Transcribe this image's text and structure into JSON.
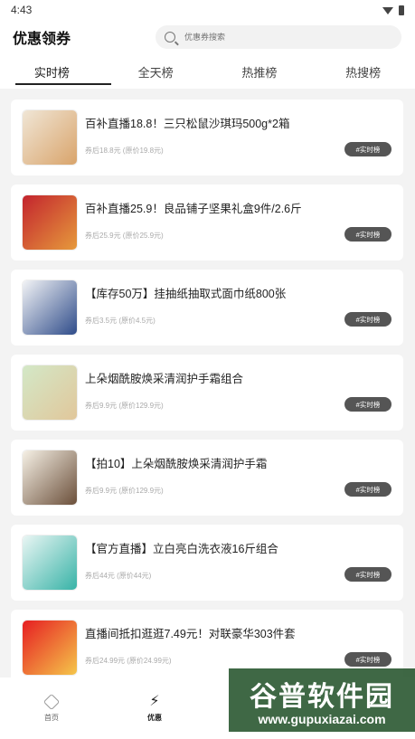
{
  "status": {
    "time": "4:43"
  },
  "header": {
    "title": "优惠领券",
    "search_placeholder": "优惠券搜索"
  },
  "tabs": [
    "实时榜",
    "全天榜",
    "热推榜",
    "热搜榜"
  ],
  "items": [
    {
      "title": "百补直播18.8！三只松鼠沙琪玛500g*2箱",
      "price": "券后18.8元 (原价19.8元)",
      "tag": "#实时榜",
      "thumb": [
        "#f0e6d6",
        "#d9a46b"
      ]
    },
    {
      "title": "百补直播25.9！良品铺子坚果礼盒9件/2.6斤",
      "price": "券后25.9元 (原价25.9元)",
      "tag": "#实时榜",
      "thumb": [
        "#c3242e",
        "#e69a3c"
      ]
    },
    {
      "title": "【库存50万】挂抽纸抽取式面巾纸800张",
      "price": "券后3.5元 (原价4.5元)",
      "tag": "#实时榜",
      "thumb": [
        "#f3f4f6",
        "#2f4c8a"
      ]
    },
    {
      "title": "上朵烟酰胺焕采清润护手霜组合",
      "price": "券后9.9元 (原价129.9元)",
      "tag": "#实时榜",
      "thumb": [
        "#d3e8c7",
        "#e1c79b"
      ]
    },
    {
      "title": "【拍10】上朵烟酰胺焕采清润护手霜",
      "price": "券后9.9元 (原价129.9元)",
      "tag": "#实时榜",
      "thumb": [
        "#f6f1e6",
        "#6b4f3a"
      ]
    },
    {
      "title": "【官方直播】立白亮白洗衣液16斤组合",
      "price": "券后44元 (原价44元)",
      "tag": "#实时榜",
      "thumb": [
        "#eaf6f4",
        "#38b3a7"
      ]
    },
    {
      "title": "直播间抵扣逛逛7.49元！对联豪华303件套",
      "price": "券后24.99元 (原价24.99元)",
      "tag": "#实时榜",
      "thumb": [
        "#e61e22",
        "#f5c64a"
      ]
    }
  ],
  "nav": [
    {
      "label": "首页"
    },
    {
      "label": "优惠"
    }
  ],
  "watermark": {
    "main": "谷普软件园",
    "sub": "www.gupuxiazai.com"
  }
}
